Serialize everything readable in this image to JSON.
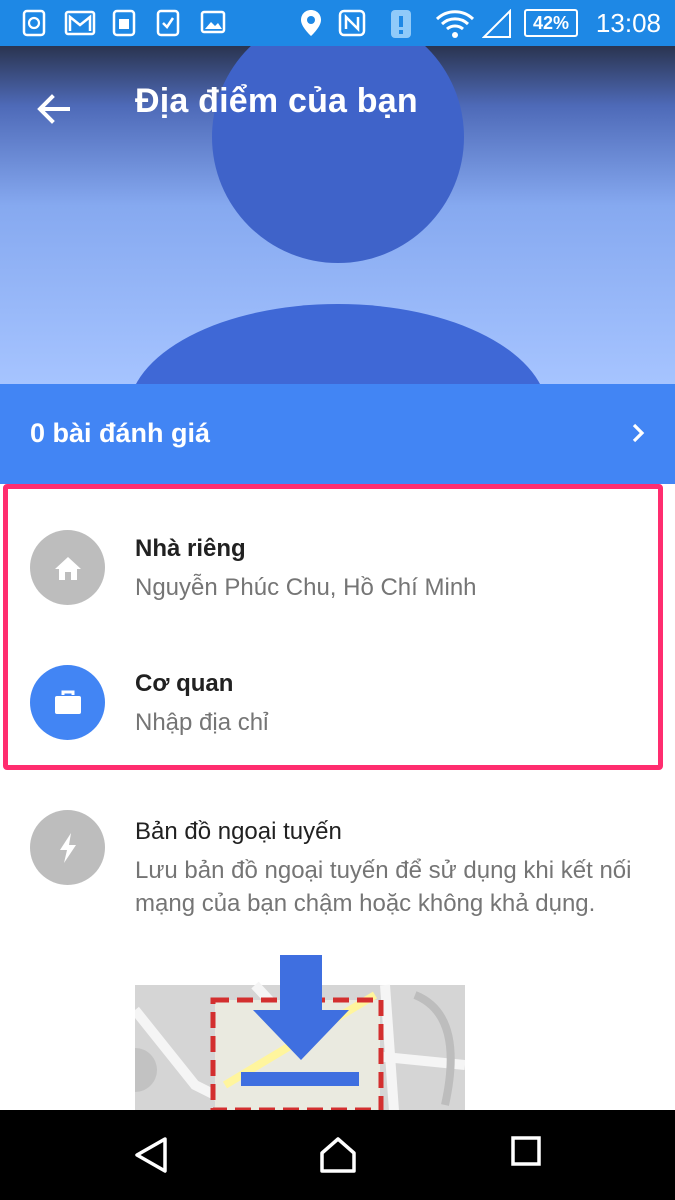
{
  "status_bar": {
    "battery": "42%",
    "time": "13:08",
    "icons": [
      "sync-icon",
      "gmail-icon",
      "sim-icon",
      "clipboard-check-icon",
      "image-icon",
      "location-icon",
      "nfc-icon",
      "alert-icon",
      "wifi-icon",
      "signal-icon",
      "battery-icon"
    ]
  },
  "header": {
    "title": "Địa điểm của bạn",
    "back_icon": "back-arrow-icon"
  },
  "reviews": {
    "label": "0 bài đánh giá",
    "icon": "chevron-right-icon"
  },
  "places": [
    {
      "name": "Nhà riêng",
      "address": "Nguyễn Phúc Chu, Hồ Chí Minh",
      "icon": "home-icon"
    },
    {
      "name": "Cơ quan",
      "address": "Nhập địa chỉ",
      "icon": "briefcase-icon"
    }
  ],
  "offline_maps": {
    "title": "Bản đồ ngoại tuyến",
    "description": "Lưu bản đồ ngoại tuyến để sử dụng khi kết nối mạng của bạn chậm hoặc không khả dụng.",
    "icon": "bolt-icon"
  },
  "nav": {
    "icons": [
      "back-icon",
      "home-icon",
      "recents-icon"
    ]
  },
  "colors": {
    "status_bar": "#1e88e5",
    "reviews_bar": "#4285f4",
    "highlight": "#ff2d6f",
    "home_circle": "#bdbdbd",
    "work_circle": "#4285f4"
  }
}
